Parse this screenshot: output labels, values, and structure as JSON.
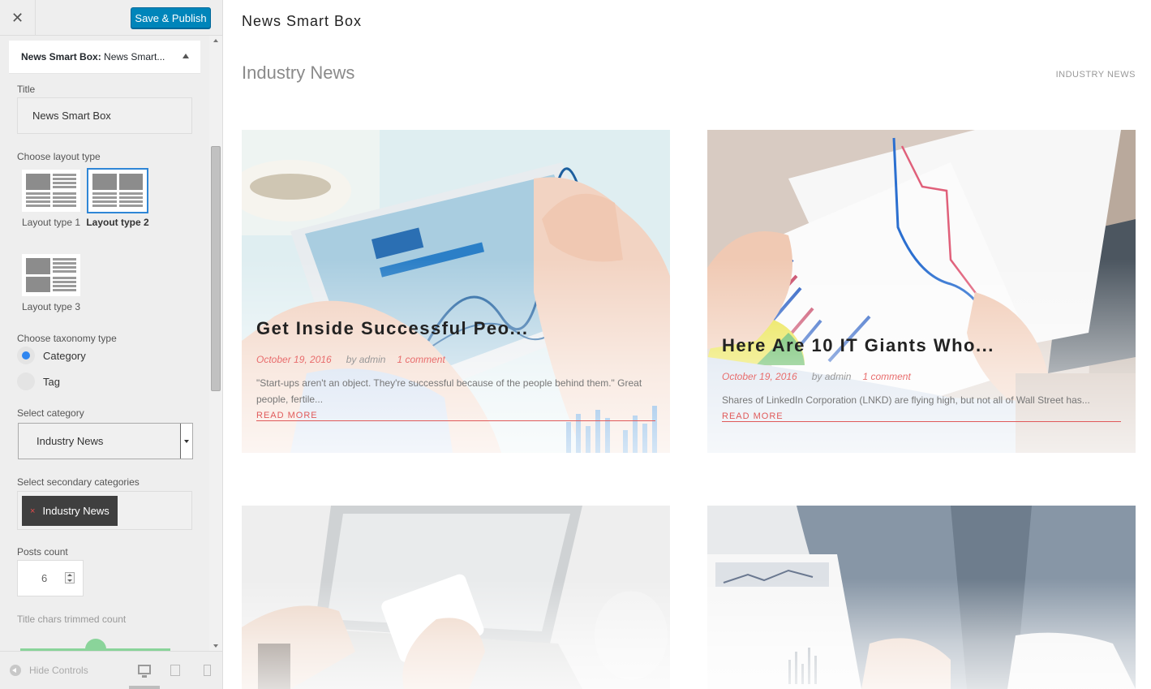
{
  "toolbar": {
    "close_label": "✕",
    "save_label": "Save & Publish"
  },
  "panel": {
    "header_widget": "News Smart Box:",
    "header_title": "News Smart...",
    "title_label": "Title",
    "title_value": "News Smart Box",
    "layout_label": "Choose layout type",
    "layouts": [
      {
        "label": "Layout type 1",
        "selected": false
      },
      {
        "label": "Layout type 2",
        "selected": true
      },
      {
        "label": "Layout type 3",
        "selected": false
      }
    ],
    "taxonomy_label": "Choose taxonomy type",
    "taxonomy_options": [
      {
        "label": "Category",
        "selected": true
      },
      {
        "label": "Tag",
        "selected": false
      }
    ],
    "category_label": "Select category",
    "category_value": "Industry News",
    "secondary_label": "Select secondary categories",
    "secondary_chip": "Industry News",
    "chip_remove": "×",
    "posts_count_label": "Posts count",
    "posts_count_value": "6",
    "trim_label": "Title chars trimmed count"
  },
  "footer": {
    "hide_controls": "Hide Controls"
  },
  "preview": {
    "widget_title": "News Smart Box",
    "section_title": "Industry News",
    "section_link": "INDUSTRY NEWS",
    "posts": [
      {
        "title": "Get Inside Successful Peo...",
        "date": "October 19, 2016",
        "author": "by admin",
        "comments": "1 comment",
        "excerpt": "\"Start-ups aren't an object. They're successful because of the people behind them.\" Great people, fertile...",
        "read_more": "READ MORE"
      },
      {
        "title": "Here Are 10 IT Giants Who...",
        "date": "October 19, 2016",
        "author": "by admin",
        "comments": "1 comment",
        "excerpt": "Shares of LinkedIn Corporation (LNKD) are flying high, but not all of Wall Street has...",
        "read_more": "READ MORE"
      }
    ]
  },
  "colors": {
    "primary_button": "#0085ba",
    "radio_selected": "#2f86f0",
    "meta_accent": "#e86d6d",
    "slider": "#8ad49a"
  }
}
